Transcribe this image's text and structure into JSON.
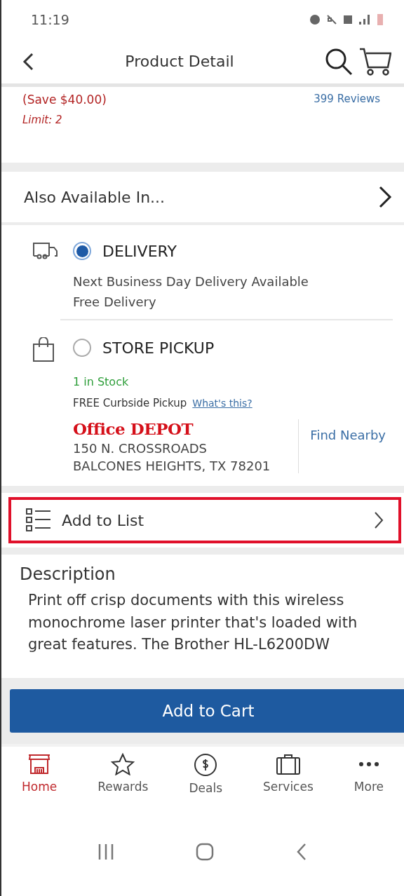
{
  "status_bar": {
    "time": "11:19"
  },
  "header": {
    "title": "Product Detail"
  },
  "price": {
    "savings": "(Save $40.00)",
    "limit": "Limit: 2",
    "reviews": "399 Reviews"
  },
  "also_available": {
    "label": "Also Available In..."
  },
  "fulfillment": [
    {
      "kind": "delivery",
      "label": "DELIVERY",
      "selected": true,
      "lines": [
        "Next Business Day Delivery Available",
        "Free Delivery"
      ]
    },
    {
      "kind": "pickup",
      "label": "STORE PICKUP",
      "selected": false,
      "stock": "1 in Stock",
      "curbside": "FREE Curbside Pickup",
      "curbside_link": "What's this?",
      "store": {
        "logo": "Office DEPOT",
        "address": [
          "150 N. CROSSROADS",
          "BALCONES HEIGHTS, TX 78201"
        ],
        "find_nearby": "Find Nearby"
      }
    }
  ],
  "add_to_list": {
    "label": "Add to List",
    "highlighted": true
  },
  "description": {
    "title": "Description",
    "text": "Print off crisp documents with this wireless monochrome laser printer that's loaded with great features. The Brother HL-L6200DW"
  },
  "add_to_cart": {
    "label": "Add to Cart"
  },
  "bottom_nav": [
    {
      "label": "Home",
      "kind": "home",
      "selected": true
    },
    {
      "label": "Rewards",
      "kind": "star",
      "selected": false
    },
    {
      "label": "Deals",
      "kind": "deals",
      "selected": false
    },
    {
      "label": "Services",
      "kind": "briefcase",
      "selected": false
    },
    {
      "label": "More",
      "kind": "more",
      "selected": false
    }
  ]
}
